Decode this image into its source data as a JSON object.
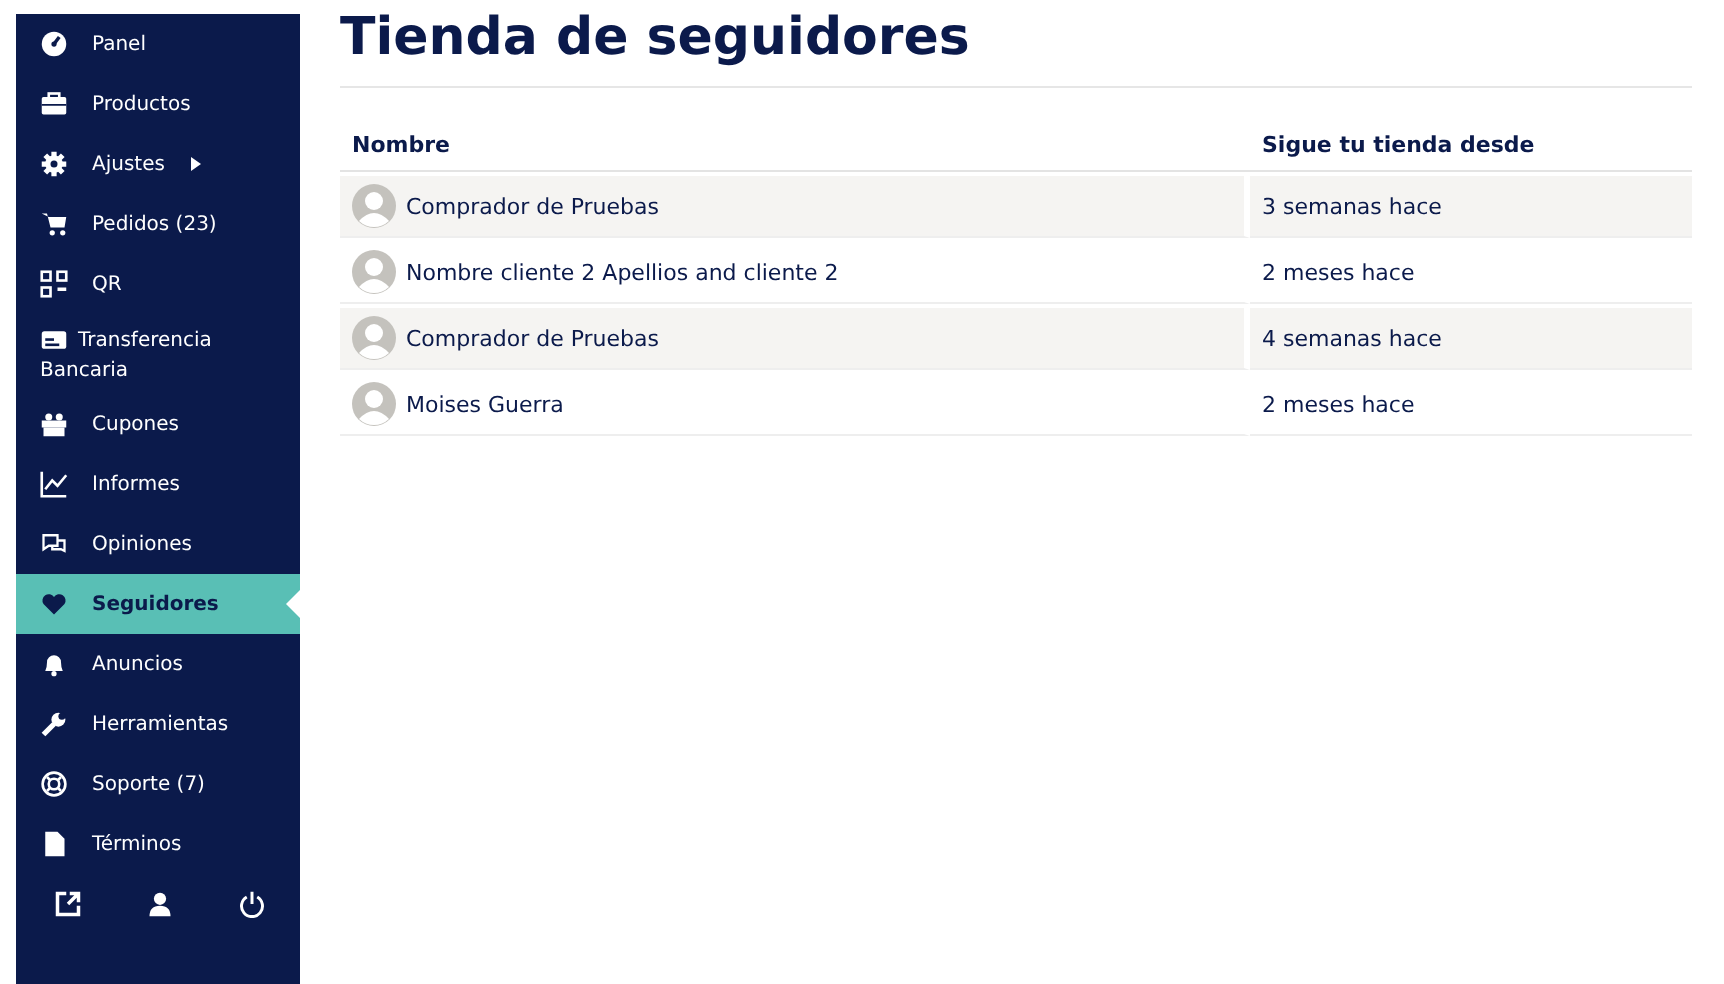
{
  "sidebar": {
    "items": [
      {
        "label": "Panel",
        "selected": false,
        "submenu": false
      },
      {
        "label": "Productos",
        "selected": false,
        "submenu": false
      },
      {
        "label": "Ajustes",
        "selected": false,
        "submenu": true
      },
      {
        "label": "Pedidos (23)",
        "selected": false,
        "submenu": false
      },
      {
        "label": "QR",
        "selected": false,
        "submenu": false
      },
      {
        "label": "Transferencia Bancaria",
        "selected": false,
        "submenu": false
      },
      {
        "label": "Cupones",
        "selected": false,
        "submenu": false
      },
      {
        "label": "Informes",
        "selected": false,
        "submenu": false
      },
      {
        "label": "Opiniones",
        "selected": false,
        "submenu": false
      },
      {
        "label": "Seguidores",
        "selected": true,
        "submenu": false
      },
      {
        "label": "Anuncios",
        "selected": false,
        "submenu": false
      },
      {
        "label": "Herramientas",
        "selected": false,
        "submenu": false
      },
      {
        "label": "Soporte (7)",
        "selected": false,
        "submenu": false
      },
      {
        "label": "Términos",
        "selected": false,
        "submenu": false
      }
    ]
  },
  "page": {
    "title": "Tienda de seguidores"
  },
  "table": {
    "columns": [
      "Nombre",
      "Sigue tu tienda desde"
    ],
    "rows": [
      {
        "name": "Comprador de Pruebas",
        "since": "3 semanas hace"
      },
      {
        "name": "Nombre cliente 2 Apellios and cliente 2",
        "since": "2 meses hace"
      },
      {
        "name": "Comprador de Pruebas",
        "since": "4 semanas hace"
      },
      {
        "name": "Moises Guerra",
        "since": "2 meses hace"
      }
    ]
  }
}
